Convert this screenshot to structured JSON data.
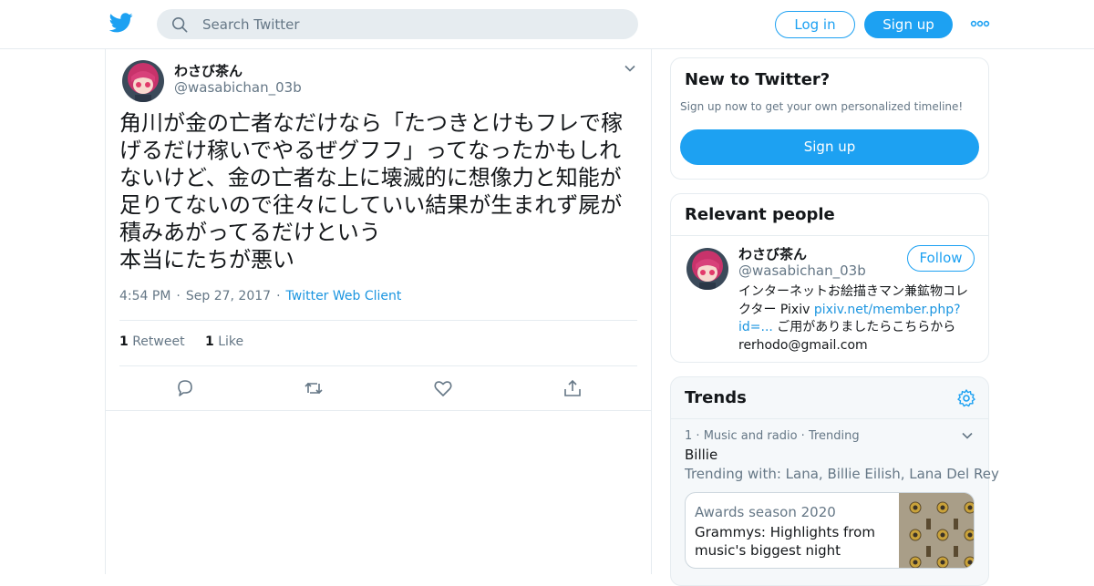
{
  "header": {
    "search_placeholder": "Search Twitter",
    "login_label": "Log in",
    "signup_label": "Sign up"
  },
  "tweet": {
    "author_name": "わさび茶ん",
    "author_handle": "@wasabichan_03b",
    "text": "角川が金の亡者なだけなら「たつきとけもフレで稼げるだけ稼いでやるぜグフフ」ってなったかもしれないけど、金の亡者な上に壊滅的に想像力と知能が足りてないので往々にしていい結果が生まれず屍が積みあがってるだけという\n本当にたちが悪い",
    "time": "4:54 PM",
    "date": "Sep 27, 2017",
    "client": "Twitter Web Client",
    "retweet_count": "1",
    "retweet_label": "Retweet",
    "like_count": "1",
    "like_label": "Like"
  },
  "sidebar": {
    "new_to_twitter": {
      "title": "New to Twitter?",
      "subtitle": "Sign up now to get your own personalized timeline!",
      "button_label": "Sign up"
    },
    "relevant_people": {
      "title": "Relevant people",
      "name": "わさび茶ん",
      "handle": "@wasabichan_03b",
      "follow_label": "Follow",
      "bio_prefix": "インターネットお絵描きマン兼鉱物コレクター Pixiv ",
      "bio_link": "pixiv.net/member.php?id=...",
      "bio_suffix": " ご用がありましたらこちらから rerhodo@gmail.com"
    },
    "trends": {
      "title": "Trends",
      "item": {
        "rank": "1",
        "category": "Music and radio",
        "status": "Trending",
        "name": "Billie",
        "trending_with": "Trending with: Lana, Billie Eilish, Lana Del Rey"
      },
      "story": {
        "category": "Awards season 2020",
        "headline": "Grammys: Highlights from music's biggest night"
      }
    }
  },
  "colors": {
    "brand": "#1da1f2",
    "link": "#1b95e0",
    "muted": "#657786",
    "border": "#e6ecf0"
  },
  "icons": [
    "twitter-bird-icon",
    "search-icon",
    "more-icon",
    "chevron-down-icon",
    "reply-icon",
    "retweet-icon",
    "like-icon",
    "share-icon",
    "gear-icon"
  ]
}
